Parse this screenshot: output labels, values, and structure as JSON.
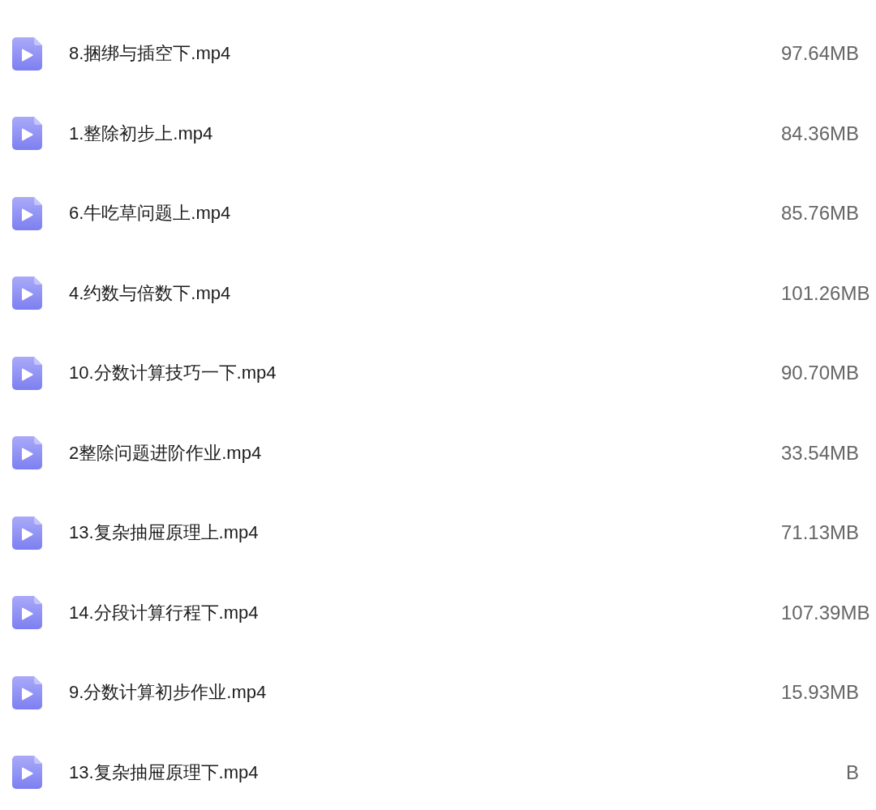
{
  "files": [
    {
      "name": "8.捆绑与插空下.mp4",
      "size": "97.64MB"
    },
    {
      "name": "1.整除初步上.mp4",
      "size": "84.36MB"
    },
    {
      "name": "6.牛吃草问题上.mp4",
      "size": "85.76MB"
    },
    {
      "name": "4.约数与倍数下.mp4",
      "size": "101.26MB"
    },
    {
      "name": "10.分数计算技巧一下.mp4",
      "size": "90.70MB"
    },
    {
      "name": "2整除问题进阶作业.mp4",
      "size": "33.54MB"
    },
    {
      "name": "13.复杂抽屉原理上.mp4",
      "size": "71.13MB"
    },
    {
      "name": "14.分段计算行程下.mp4",
      "size": "107.39MB"
    },
    {
      "name": "9.分数计算初步作业.mp4",
      "size": "15.93MB"
    },
    {
      "name": "13.复杂抽屉原理下.mp4",
      "size": "B"
    }
  ]
}
